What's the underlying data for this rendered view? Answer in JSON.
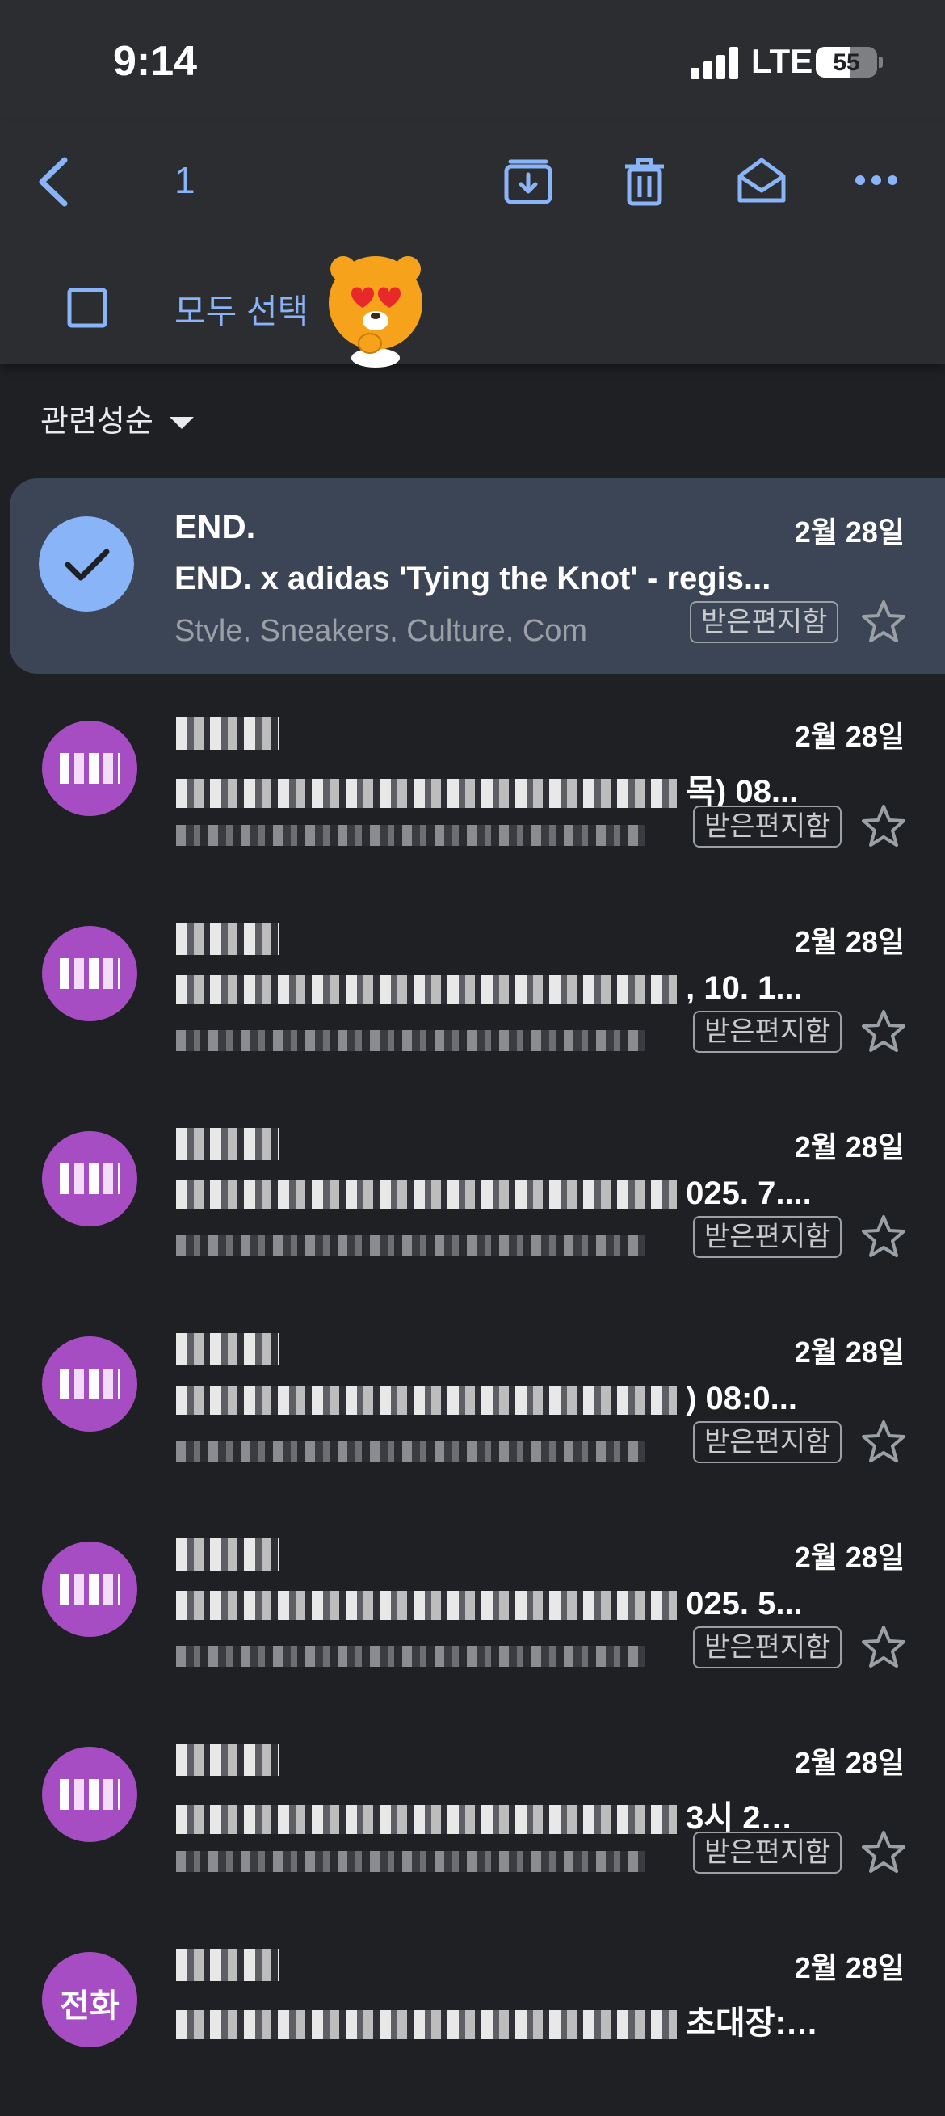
{
  "status_bar": {
    "time": "9:14",
    "network": "LTE",
    "battery": "55",
    "battery_level": 0.55
  },
  "action_bar": {
    "back_icon": "arrow-left-icon",
    "selected_count": "1",
    "archive_icon": "archive-icon",
    "delete_icon": "trash-icon",
    "mark_read_icon": "envelope-open-icon",
    "more_icon": "more-horizontal-icon",
    "select_all_label": "모두 선택"
  },
  "sort": {
    "label": "관련성순"
  },
  "colors": {
    "accent": "#8ab4f8",
    "selected_row": "#3b4556",
    "avatar_purple": "#a64dc4",
    "background": "#1f2023",
    "toolbar": "#2b2d31"
  },
  "emails": [
    {
      "sender": "END.",
      "date": "2월 28일",
      "subject": "END. x adidas 'Tying the Knot' - regis...",
      "snippet": "Style, Sneakers, Culture, Com",
      "label": "받은편지함",
      "selected": true
    },
    {
      "sender": "",
      "date": "2월 28일",
      "subject": "목) 08...",
      "snippet": "",
      "label": "받은편지함",
      "selected": false
    },
    {
      "sender": "",
      "date": "2월 28일",
      "subject": ", 10. 1...",
      "snippet": "",
      "label": "받은편지함",
      "selected": false
    },
    {
      "sender": "",
      "date": "2월 28일",
      "subject": "025. 7....",
      "snippet": "",
      "label": "받은편지함",
      "selected": false
    },
    {
      "sender": "",
      "date": "2월 28일",
      "subject": ") 08:0...",
      "snippet": "",
      "label": "받은편지함",
      "selected": false
    },
    {
      "sender": "",
      "date": "2월 28일",
      "subject": "025. 5...",
      "snippet": "",
      "label": "받은편지함",
      "selected": false
    },
    {
      "sender": "",
      "date": "2월 28일",
      "subject": "3시 2…",
      "snippet": "",
      "label": "받은편지함",
      "selected": false
    },
    {
      "sender": "",
      "date": "2월 28일",
      "subject": "초대장: 수영 4시부 ( 커런에 3시 25분 차량옴...",
      "snippet": "",
      "label": "",
      "selected": false,
      "avatar_text": "전화"
    }
  ]
}
